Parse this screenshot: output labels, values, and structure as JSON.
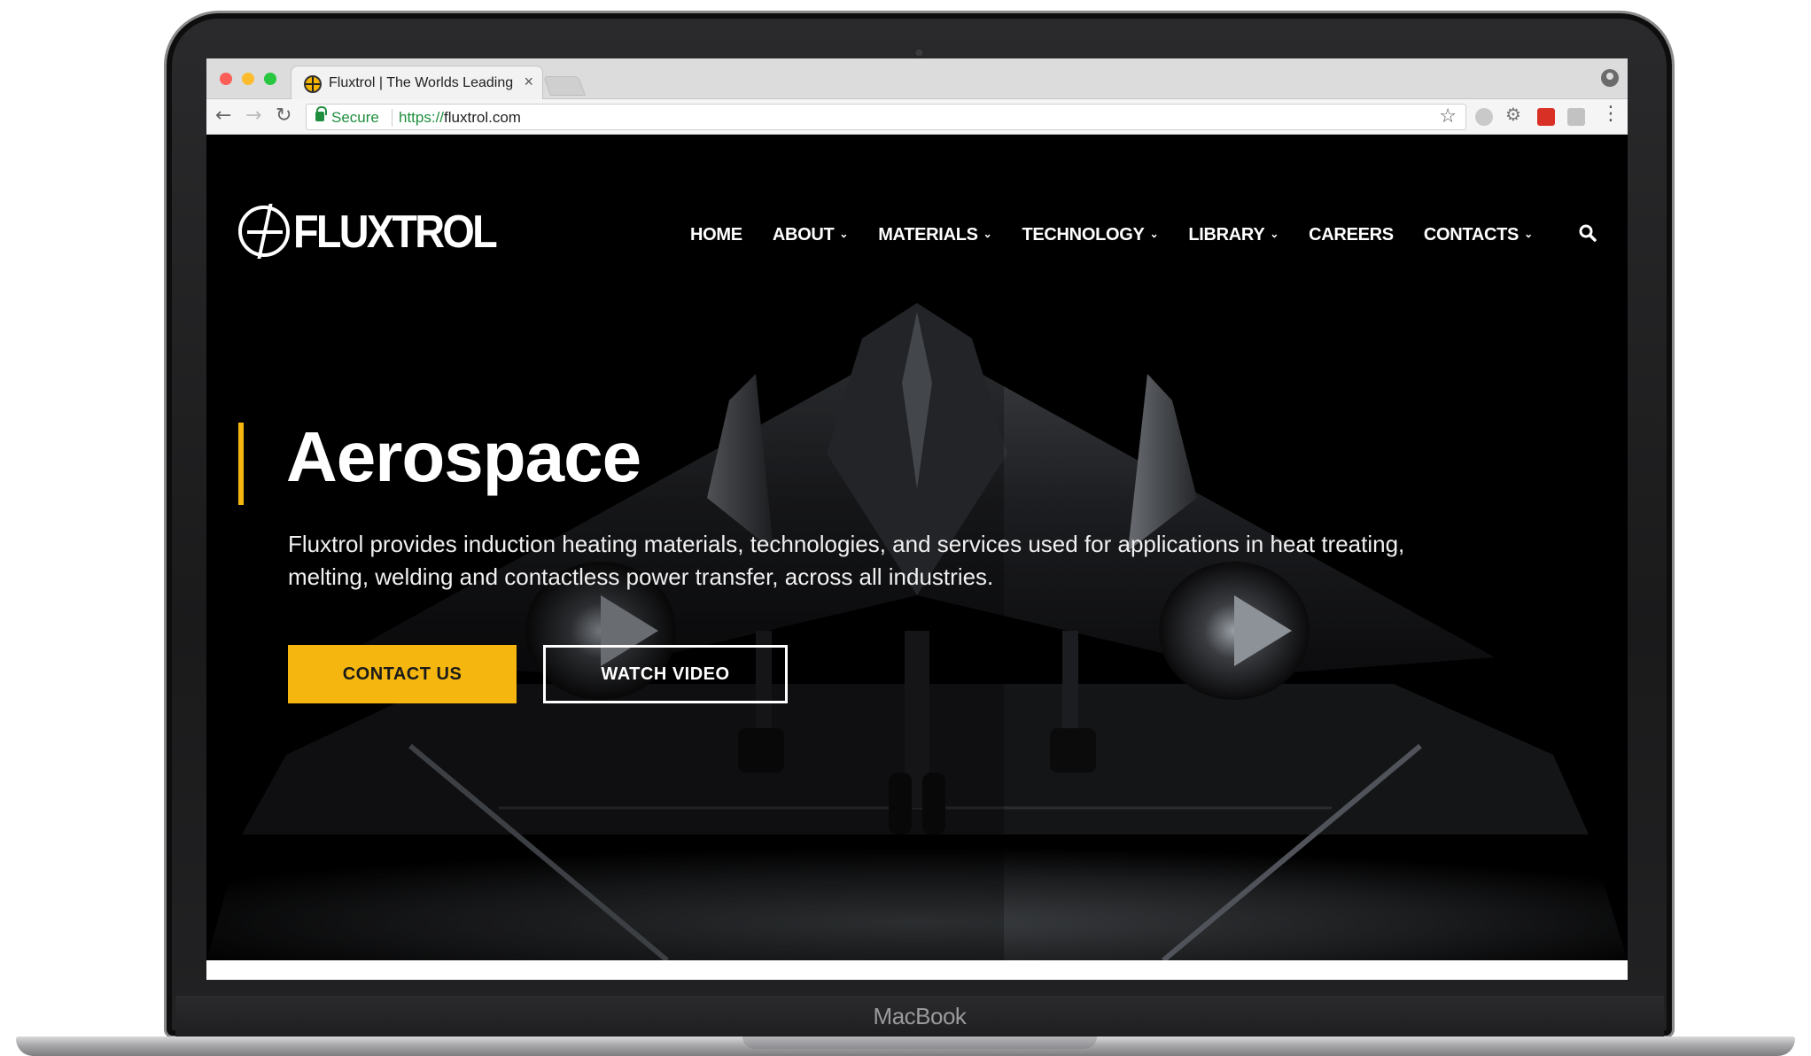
{
  "device": {
    "label": "MacBook"
  },
  "browser": {
    "tab_title": "Fluxtrol | The Worlds Leading I",
    "tab_close": "×",
    "secure_label": "Secure",
    "url_scheme": "https://",
    "url_host": "fluxtrol.com",
    "back": "←",
    "forward": "→",
    "reload": "↻",
    "star": "☆",
    "menu": "⋮"
  },
  "site": {
    "logo_text": "FLUXTROL",
    "nav": [
      {
        "label": "HOME",
        "has_dropdown": false
      },
      {
        "label": "ABOUT",
        "has_dropdown": true
      },
      {
        "label": "MATERIALS",
        "has_dropdown": true
      },
      {
        "label": "TECHNOLOGY",
        "has_dropdown": true
      },
      {
        "label": "LIBRARY",
        "has_dropdown": true
      },
      {
        "label": "CAREERS",
        "has_dropdown": false
      },
      {
        "label": "CONTACTS",
        "has_dropdown": true
      }
    ],
    "chevron": "⌄",
    "hero": {
      "title": "Aerospace",
      "text": "Fluxtrol provides induction heating materials, technologies, and services used for applications in heat treating, melting, welding and contactless power transfer, across all industries.",
      "cta_primary": "CONTACT US",
      "cta_secondary": "WATCH VIDEO"
    }
  },
  "colors": {
    "accent": "#f5b70f",
    "secure_green": "#1e8e3e",
    "hero_bg": "#000000"
  }
}
